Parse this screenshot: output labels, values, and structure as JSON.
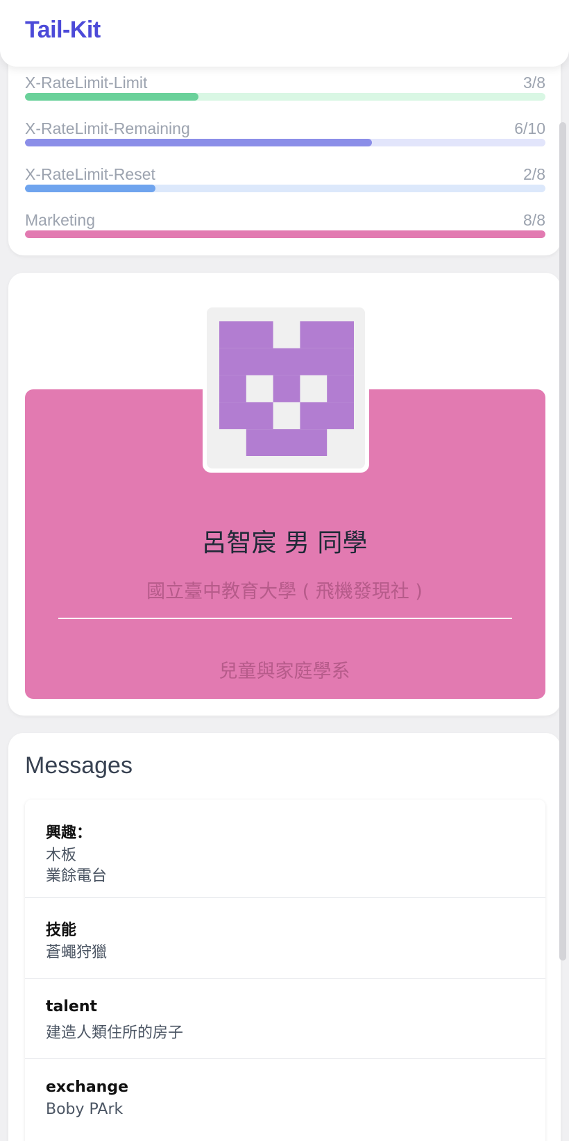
{
  "app": {
    "brand": "Tail-Kit"
  },
  "rate_limits": [
    {
      "label": "X-RateLimit-Limit",
      "value": "3/8",
      "fraction": 0.333,
      "color": "#6ad19a",
      "track": "#d9f7e4"
    },
    {
      "label": "X-RateLimit-Remaining",
      "value": "6/10",
      "fraction": 0.667,
      "color": "#8b8ee8",
      "track": "#e2e5fb"
    },
    {
      "label": "X-RateLimit-Reset",
      "value": "2/8",
      "fraction": 0.25,
      "color": "#6fa4ee",
      "track": "#dce8fb"
    },
    {
      "label": "Marketing",
      "value": "8/8",
      "fraction": 1.0,
      "color": "#e27ab1",
      "track": "#fde6f1"
    }
  ],
  "profile": {
    "name": "呂智宸 男 同學",
    "school": "國立臺中教育大學 ( 飛機發現社 )",
    "department": "兒童與家庭學系",
    "avatar_icon": "identicon",
    "panel_color": "#e27ab1"
  },
  "messages": {
    "title": "Messages",
    "items": [
      {
        "heading": "興趣：",
        "lines": [
          "木板",
          "業餘電台"
        ]
      },
      {
        "heading": "技能",
        "lines": [
          "蒼蠅狩獵"
        ]
      },
      {
        "heading": "talent",
        "lines": [
          "建造人類住所的房子"
        ]
      },
      {
        "heading": "exchange",
        "lines": [
          "Boby PArk"
        ]
      }
    ]
  }
}
